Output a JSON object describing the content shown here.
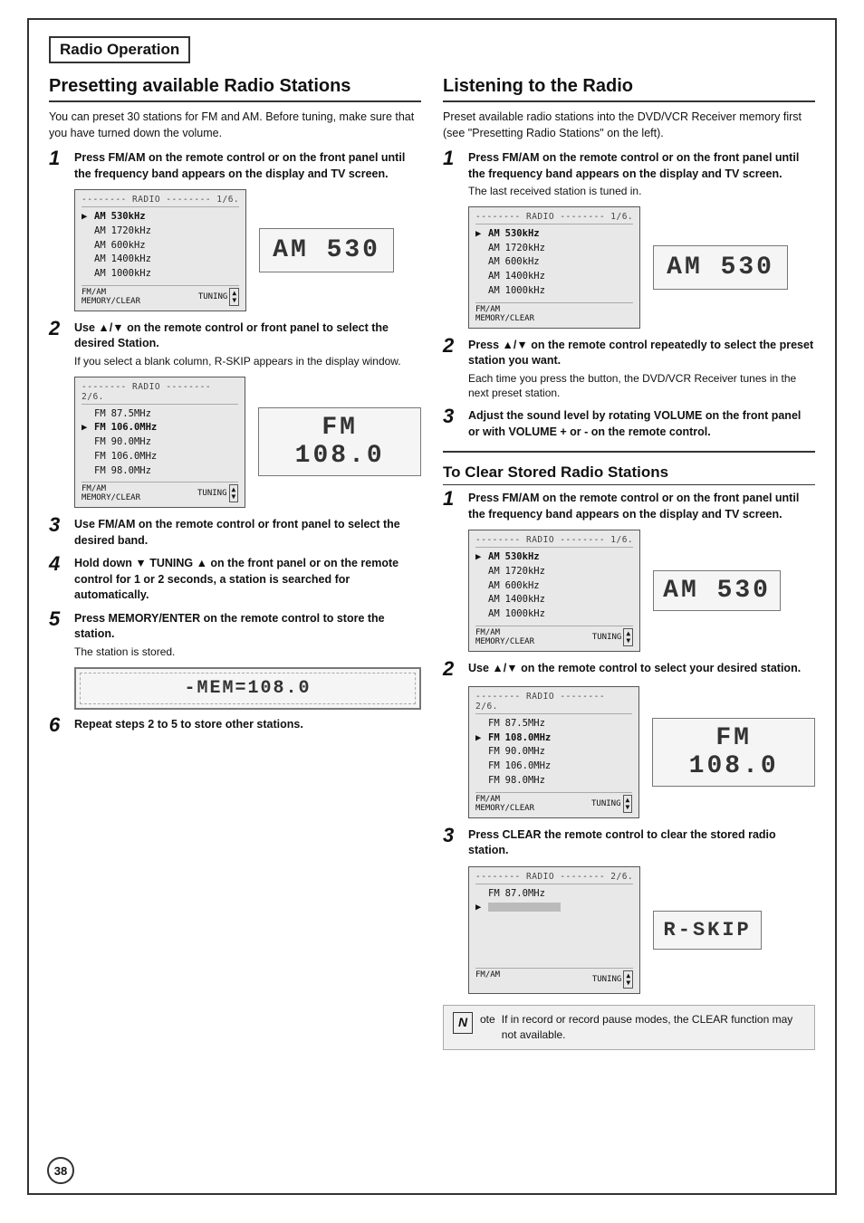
{
  "page": {
    "section_title": "Radio Operation",
    "page_number": "38"
  },
  "presetting": {
    "title": "Presetting available Radio Stations",
    "intro": "You can preset 30 stations for FM and AM. Before tuning, make sure that you have turned down the volume.",
    "steps": [
      {
        "num": "1",
        "text": "Press FM/AM on the remote control or on the front panel until the frequency band appears on the display and TV screen."
      },
      {
        "num": "2",
        "text": "Use ▲/▼ on the remote control or front panel to select the desired Station.",
        "subtext": "If you select a blank column, R-SKIP appears in the display window."
      },
      {
        "num": "3",
        "text": "Use FM/AM on the remote control or front panel to select the desired band."
      },
      {
        "num": "4",
        "text": "Hold down ▼ TUNING ▲  on the front panel or on the remote control for 1 or 2 seconds, a station is searched for automatically."
      },
      {
        "num": "5",
        "text": "Press MEMORY/ENTER on the remote control to store the station.",
        "subtext": "The station is stored."
      },
      {
        "num": "6",
        "text": "Repeat steps 2 to 5 to store other stations."
      }
    ],
    "lcd1": {
      "header": "-------- RADIO -------- 1/6.",
      "rows": [
        {
          "arrow": "▶",
          "band": "AM",
          "freq": "530kHz",
          "selected": true
        },
        {
          "arrow": " ",
          "band": "AM",
          "freq": "1720kHz",
          "selected": false
        },
        {
          "arrow": " ",
          "band": "AM",
          "freq": "600kHz",
          "selected": false
        },
        {
          "arrow": " ",
          "band": "AM",
          "freq": "1400kHz",
          "selected": false
        },
        {
          "arrow": " ",
          "band": "AM",
          "freq": "1000kHz",
          "selected": false
        }
      ],
      "footer_left": "FM/AM\nMEMORY/CLEAR",
      "footer_right": "TUNING ▲/▼"
    },
    "display1": "AM  530",
    "lcd2": {
      "header": "-------- RADIO -------- 2/6.",
      "rows": [
        {
          "arrow": " ",
          "band": "FM",
          "freq": "87.5MHz",
          "selected": false
        },
        {
          "arrow": "▶",
          "band": "FM",
          "freq": "106.0MHz",
          "selected": true
        },
        {
          "arrow": " ",
          "band": "FM",
          "freq": "90.0MHz",
          "selected": false
        },
        {
          "arrow": " ",
          "band": "FM",
          "freq": "106.0MHz",
          "selected": false
        },
        {
          "arrow": " ",
          "band": "FM",
          "freq": "98.0MHz",
          "selected": false
        }
      ],
      "footer_left": "FM/AM\nMEMORY/CLEAR",
      "footer_right": "TUNING ▲/▼"
    },
    "display2": "FM 108.0",
    "display_mem": "-MEM=108.0"
  },
  "listening": {
    "title": "Listening to the Radio",
    "intro": "Preset available radio stations into the DVD/VCR Receiver memory first (see \"Presetting Radio Stations\" on the left).",
    "steps": [
      {
        "num": "1",
        "text": "Press FM/AM on the remote control or on the front panel until the frequency band appears on the display and TV screen.",
        "subtext": "The last received station is tuned in."
      },
      {
        "num": "2",
        "text": "Press ▲/▼ on the remote control repeatedly to select the preset station you want.",
        "subtext": "Each time you press the button, the DVD/VCR Receiver tunes in the next preset station."
      },
      {
        "num": "3",
        "text": "Adjust the sound level by rotating VOLUME on the front panel or with VOLUME + or - on the remote control."
      }
    ],
    "lcd1": {
      "header": "-------- RADIO -------- 1/6.",
      "rows": [
        {
          "arrow": "▶",
          "band": "AM",
          "freq": "530kHz",
          "selected": true
        },
        {
          "arrow": " ",
          "band": "AM",
          "freq": "1720kHz",
          "selected": false
        },
        {
          "arrow": " ",
          "band": "AM",
          "freq": "600kHz",
          "selected": false
        },
        {
          "arrow": " ",
          "band": "AM",
          "freq": "1400kHz",
          "selected": false
        },
        {
          "arrow": " ",
          "band": "AM",
          "freq": "1000kHz",
          "selected": false
        }
      ],
      "footer_left": "FM/AM\nMEMORY/CLEAR"
    },
    "display1": "AM  530"
  },
  "clear": {
    "title": "To Clear Stored Radio Stations",
    "steps": [
      {
        "num": "1",
        "text": "Press FM/AM on the remote control or on the front panel until the frequency band appears on the display and TV screen."
      },
      {
        "num": "2",
        "text": "Use ▲/▼ on the remote control to select your desired station."
      },
      {
        "num": "3",
        "text": "Press CLEAR the remote control to clear the stored radio station."
      }
    ],
    "lcd1": {
      "header": "-------- RADIO -------- 1/6.",
      "rows": [
        {
          "arrow": "▶",
          "band": "AM",
          "freq": "530kHz",
          "selected": true
        },
        {
          "arrow": " ",
          "band": "AM",
          "freq": "1720kHz",
          "selected": false
        },
        {
          "arrow": " ",
          "band": "AM",
          "freq": "600kHz",
          "selected": false
        },
        {
          "arrow": " ",
          "band": "AM",
          "freq": "1400kHz",
          "selected": false
        },
        {
          "arrow": " ",
          "band": "AM",
          "freq": "1000kHz",
          "selected": false
        }
      ],
      "footer_left": "FM/AM\nMEMORY/CLEAR",
      "footer_right": "TUNING ▲/▼"
    },
    "display1": "AM  530",
    "lcd2": {
      "header": "-------- RADIO -------- 2/6.",
      "rows": [
        {
          "arrow": " ",
          "band": "FM",
          "freq": "87.5MHz",
          "selected": false
        },
        {
          "arrow": "▶",
          "band": "FM",
          "freq": "108.0MHz",
          "selected": true
        },
        {
          "arrow": " ",
          "band": "FM",
          "freq": "90.0MHz",
          "selected": false
        },
        {
          "arrow": " ",
          "band": "FM",
          "freq": "106.0MHz",
          "selected": false
        },
        {
          "arrow": " ",
          "band": "FM",
          "freq": "98.0MHz",
          "selected": false
        }
      ],
      "footer_left": "FM/AM\nMEMORY/CLEAR",
      "footer_right": "TUNING ▲/▼"
    },
    "display2": "FM 108.0",
    "lcd3": {
      "header": "-------- RADIO -------- 2/6.",
      "rows": [
        {
          "arrow": " ",
          "band": "FM",
          "freq": "87.0MHz",
          "selected": false
        },
        {
          "arrow": "▶",
          "band": "",
          "freq": "",
          "selected": true
        }
      ],
      "footer_left": "FM/AM",
      "footer_right": "TUNING ▲/▼"
    },
    "display3": "R-SKIP"
  },
  "note": {
    "icon": "N",
    "text": "If in record or record pause modes, the CLEAR function may not available."
  }
}
